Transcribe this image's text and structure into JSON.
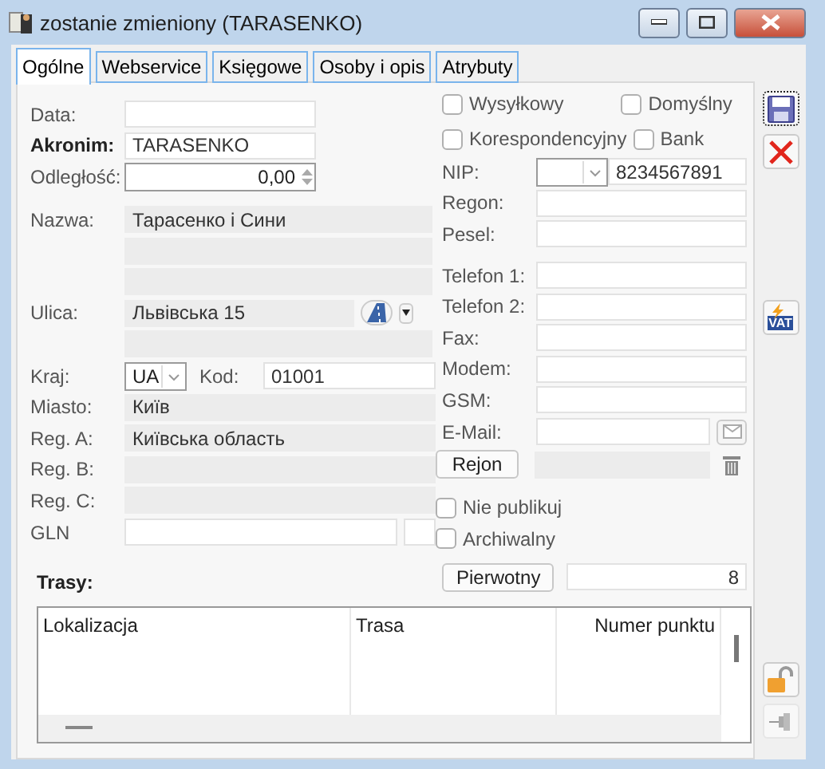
{
  "window": {
    "title": "zostanie zmieniony (TARASENKO)"
  },
  "tabs": [
    {
      "label": "Ogólne",
      "selected": true
    },
    {
      "label": "Webservice",
      "selected": false
    },
    {
      "label": "Księgowe",
      "selected": false
    },
    {
      "label": "Osoby i opis",
      "selected": false
    },
    {
      "label": "Atrybuty",
      "selected": false
    }
  ],
  "left": {
    "data": {
      "label": "Data:"
    },
    "akronim": {
      "label": "Akronim:",
      "value": "TARASENKO"
    },
    "odleglosc": {
      "label": "Odległość:",
      "value": "0,00"
    },
    "nazwa": {
      "label": "Nazwa:",
      "value": "Тарасенко і Сини"
    },
    "ulica": {
      "label": "Ulica:",
      "value": "Львівська 15"
    },
    "kraj": {
      "label": "Kraj:",
      "value": "UA"
    },
    "kod": {
      "label": "Kod:",
      "value": "01001"
    },
    "regions": [
      {
        "label": "Miasto:",
        "value": "Київ"
      },
      {
        "label": "Reg. A:",
        "value": "Київська область"
      },
      {
        "label": "Reg. B:"
      },
      {
        "label": "Reg. C:"
      }
    ],
    "gln": {
      "label": "GLN"
    }
  },
  "flags": [
    {
      "label": "Wysyłkowy",
      "checked": false
    },
    {
      "label": "Domyślny",
      "checked": false
    },
    {
      "label": "Korespondencyjny",
      "checked": false
    },
    {
      "label": "Bank",
      "checked": false
    }
  ],
  "right_fields": [
    {
      "kind": "combo",
      "label": "NIP:",
      "value": "8234567891"
    },
    {
      "kind": "text",
      "label": "Regon:"
    },
    {
      "kind": "text",
      "label": "Pesel:"
    },
    {
      "kind": "gap"
    },
    {
      "kind": "text",
      "label": "Telefon 1:"
    },
    {
      "kind": "text",
      "label": "Telefon 2:"
    },
    {
      "kind": "text",
      "label": "Fax:"
    },
    {
      "kind": "text",
      "label": "Modem:"
    },
    {
      "kind": "text",
      "label": "GSM:"
    },
    {
      "kind": "email",
      "label": "E-Mail:"
    }
  ],
  "rejon_button": "Rejon",
  "options": [
    {
      "label": "Nie publikuj",
      "checked": false
    },
    {
      "label": "Archiwalny",
      "checked": false
    }
  ],
  "routes": {
    "label": "Trasy:",
    "button": "Pierwotny",
    "count": "8",
    "columns": [
      "Lokalizacja",
      "Trasa",
      "Numer punktu"
    ]
  },
  "vat_button": {
    "label": "VAT"
  }
}
